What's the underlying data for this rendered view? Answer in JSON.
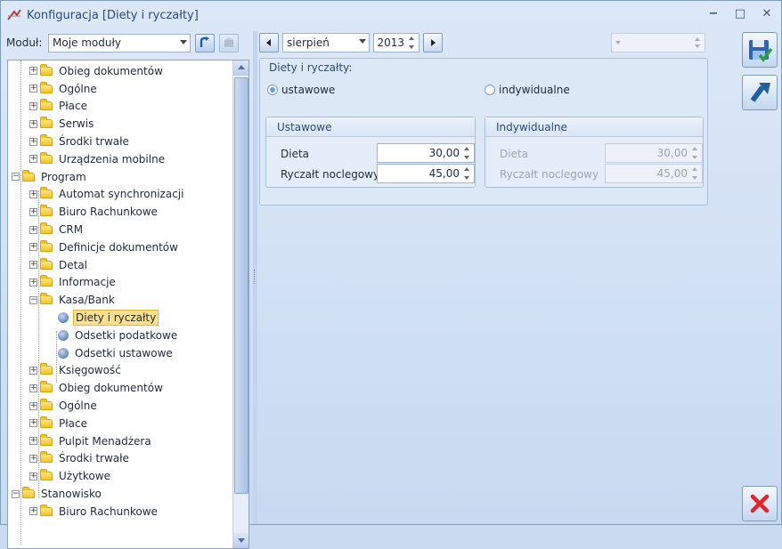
{
  "window": {
    "title": "Konfiguracja [Diety i ryczałty]",
    "controls": [
      "−",
      "□",
      "✕"
    ]
  },
  "modul": {
    "label": "Moduł:",
    "value": "Moje moduły"
  },
  "tree": [
    {
      "label": "Obieg dokumentów",
      "level": 2,
      "type": "folder",
      "expander": "+"
    },
    {
      "label": "Ogólne",
      "level": 2,
      "type": "folder",
      "expander": "+"
    },
    {
      "label": "Płace",
      "level": 2,
      "type": "folder",
      "expander": "+"
    },
    {
      "label": "Serwis",
      "level": 2,
      "type": "folder",
      "expander": "+"
    },
    {
      "label": "Środki trwałe",
      "level": 2,
      "type": "folder",
      "expander": "+"
    },
    {
      "label": "Urządzenia mobilne",
      "level": 2,
      "type": "folder",
      "expander": "+"
    },
    {
      "label": "Program",
      "level": 1,
      "type": "folder",
      "expander": "−"
    },
    {
      "label": "Automat synchronizacji",
      "level": 2,
      "type": "folder",
      "expander": "+"
    },
    {
      "label": "Biuro Rachunkowe",
      "level": 2,
      "type": "folder",
      "expander": "+"
    },
    {
      "label": "CRM",
      "level": 2,
      "type": "folder",
      "expander": "+"
    },
    {
      "label": "Definicje dokumentów",
      "level": 2,
      "type": "folder",
      "expander": "+"
    },
    {
      "label": "Detal",
      "level": 2,
      "type": "folder",
      "expander": "+"
    },
    {
      "label": "Informacje",
      "level": 2,
      "type": "folder",
      "expander": "+"
    },
    {
      "label": "Kasa/Bank",
      "level": 2,
      "type": "folder",
      "expander": "−"
    },
    {
      "label": "Diety i ryczałty",
      "level": 3,
      "type": "leaf",
      "expander": "",
      "selected": true
    },
    {
      "label": "Odsetki podatkowe",
      "level": 3,
      "type": "leaf",
      "expander": ""
    },
    {
      "label": "Odsetki ustawowe",
      "level": 3,
      "type": "leaf",
      "expander": ""
    },
    {
      "label": "Księgowość",
      "level": 2,
      "type": "folder",
      "expander": "+"
    },
    {
      "label": "Obieg dokumentów",
      "level": 2,
      "type": "folder",
      "expander": "+"
    },
    {
      "label": "Ogólne",
      "level": 2,
      "type": "folder",
      "expander": "+"
    },
    {
      "label": "Płace",
      "level": 2,
      "type": "folder",
      "expander": "+"
    },
    {
      "label": "Pulpit Menadżera",
      "level": 2,
      "type": "folder",
      "expander": "+"
    },
    {
      "label": "Środki trwałe",
      "level": 2,
      "type": "folder",
      "expander": "+"
    },
    {
      "label": "Użytkowe",
      "level": 2,
      "type": "folder",
      "expander": "+"
    },
    {
      "label": "Stanowisko",
      "level": 1,
      "type": "folder",
      "expander": "−"
    },
    {
      "label": "Biuro Rachunkowe",
      "level": 2,
      "type": "folder",
      "expander": "+"
    }
  ],
  "period": {
    "month": "sierpień",
    "year": "2013"
  },
  "main_group": {
    "title": "Diety i ryczałty:",
    "radio_ustawowe": "ustawowe",
    "radio_indywidualne": "indywidualne"
  },
  "ustawowe": {
    "title": "Ustawowe",
    "dieta_label": "Dieta",
    "dieta_value": "30,00",
    "nocleg_label": "Ryczałt noclegowy",
    "nocleg_value": "45,00"
  },
  "indywidualne": {
    "title": "Indywidualne",
    "dieta_label": "Dieta",
    "dieta_value": "30,00",
    "nocleg_label": "Ryczałt noclegowy",
    "nocleg_value": "45,00"
  },
  "colors": {
    "accent": "#2a4a7a",
    "selected_bg": "#ffe08a",
    "window_bg": "#c9dbf1"
  },
  "icons": [
    "app-icon",
    "refresh-icon",
    "clear-icon",
    "save-icon",
    "undo-icon",
    "cancel-icon"
  ]
}
